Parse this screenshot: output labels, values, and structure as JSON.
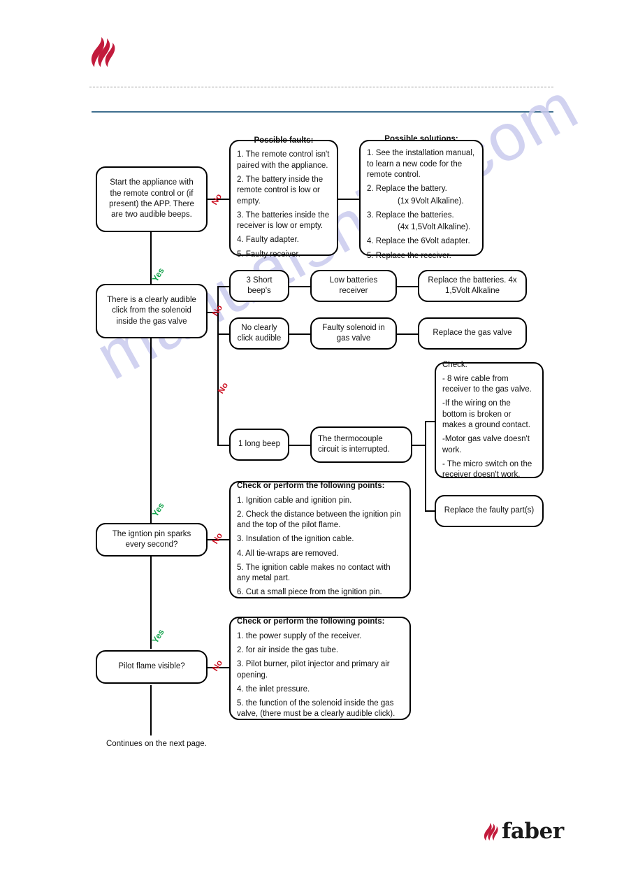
{
  "header": {
    "logo_icon": "faber-flame-logo-icon"
  },
  "watermark": {
    "text": "manualshive.com"
  },
  "flow": {
    "start": {
      "text": "Start the appliance with the remote control or (if present) the APP. There are two audible beeps."
    },
    "faults": {
      "title": "Possible faults:",
      "items": [
        "1. The remote control isn't paired with the appliance.",
        "2. The battery inside the remote control is low or empty.",
        "3. The batteries inside the receiver is low or empty.",
        "4. Faulty adapter.",
        "5. Faulty receiver."
      ]
    },
    "solutions": {
      "title": "Possible solutions:",
      "items": [
        "1. See the installation manual, to learn a new code for the remote control.",
        "2. Replace the battery.",
        "(1x 9Volt Alkaline).",
        "3. Replace the batteries.",
        "(4x 1,5Volt Alkaline).",
        "4. Replace the 6Volt adapter.",
        "5. Replace the receiver."
      ]
    },
    "click_question": {
      "text": "There is a clearly audible click from the solenoid inside the gas valve"
    },
    "three_beeps": {
      "text": "3 Short beep's"
    },
    "low_batteries": {
      "text": "Low batteries receiver"
    },
    "replace_batteries": {
      "text": "Replace the batteries. 4x 1,5Volt Alkaline"
    },
    "no_click": {
      "text": "No clearly click audible"
    },
    "faulty_solenoid": {
      "text": "Faulty solenoid in gas valve"
    },
    "replace_gas_valve": {
      "text": "Replace the gas valve"
    },
    "one_long_beep": {
      "text": "1 long beep"
    },
    "thermocouple": {
      "text": "The thermocouple circuit is interrupted."
    },
    "check_wiring": {
      "title": "Check:",
      "items": [
        "- 8 wire cable from receiver to the gas valve.",
        "-If the wiring on the bottom is broken or makes a ground contact.",
        "-Motor gas valve doesn't work.",
        "- The micro switch on the receiver doesn't work."
      ]
    },
    "replace_faulty": {
      "text": "Replace the faulty part(s)"
    },
    "ignition_question": {
      "text": "The igntion pin sparks every second?"
    },
    "ignition_checks": {
      "title": "Check or perform the following points:",
      "items": [
        "1. Ignition cable and ignition pin.",
        "2. Check the distance between the ignition pin and the top of the pilot flame.",
        "3. Insulation of the ignition cable.",
        "4. All tie-wraps are removed.",
        "5. The ignition cable makes no contact with any metal part.",
        "6. Cut a small piece from the ignition pin."
      ]
    },
    "pilot_question": {
      "text": "Pilot flame visible?"
    },
    "pilot_checks": {
      "title": "Check or perform the following points:",
      "items": [
        "1. the power supply of the receiver.",
        "2. for air inside the gas tube.",
        "3. Pilot burner, pilot injector and primary air opening.",
        "4. the inlet pressure.",
        "5. the function of the solenoid inside the gas valve, (there must be a clearly audible click)."
      ]
    },
    "branch_labels": {
      "yes": "Yes",
      "no": "No"
    }
  },
  "footer": {
    "brand": "faber",
    "continues": "Continues on the next page."
  }
}
